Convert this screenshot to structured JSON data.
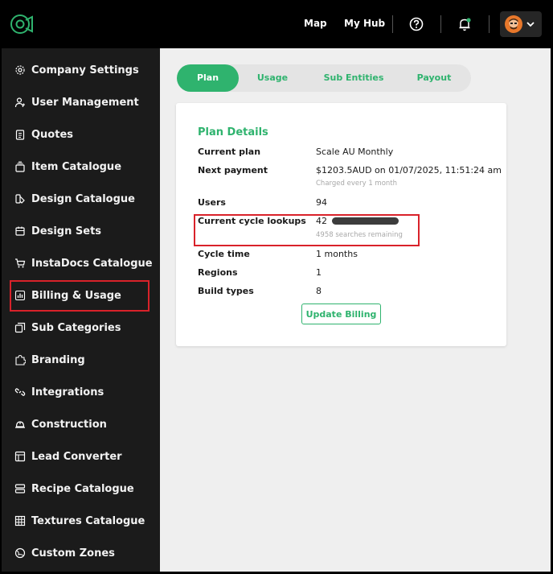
{
  "topbar": {
    "nav": [
      "Map",
      "My Hub"
    ],
    "icons": [
      "help-icon",
      "notification-bell-icon",
      "chevron-down-icon"
    ],
    "notification_dot_color": "#2fb36e"
  },
  "sidebar": {
    "items": [
      {
        "label": "Company Settings",
        "icon": "gear-icon"
      },
      {
        "label": "User Management",
        "icon": "user-icon"
      },
      {
        "label": "Quotes",
        "icon": "clipboard-icon"
      },
      {
        "label": "Item Catalogue",
        "icon": "stack-icon"
      },
      {
        "label": "Design Catalogue",
        "icon": "design-icon"
      },
      {
        "label": "Design Sets",
        "icon": "calendar-icon"
      },
      {
        "label": "InstaDocs Catalogue",
        "icon": "cart-icon"
      },
      {
        "label": "Billing & Usage",
        "icon": "bar-chart-icon",
        "active": true
      },
      {
        "label": "Sub Categories",
        "icon": "sub-categories-icon"
      },
      {
        "label": "Branding",
        "icon": "puzzle-icon"
      },
      {
        "label": "Integrations",
        "icon": "link-icon"
      },
      {
        "label": "Construction",
        "icon": "hardhat-icon"
      },
      {
        "label": "Lead Converter",
        "icon": "layout-icon"
      },
      {
        "label": "Recipe Catalogue",
        "icon": "server-icon"
      },
      {
        "label": "Textures Catalogue",
        "icon": "grid-icon"
      },
      {
        "label": "Custom Zones",
        "icon": "globe-icon"
      }
    ]
  },
  "tabs": [
    {
      "label": "Plan",
      "active": true
    },
    {
      "label": "Usage"
    },
    {
      "label": "Sub Entities"
    },
    {
      "label": "Payout"
    }
  ],
  "plan": {
    "title": "Plan Details",
    "rows": [
      {
        "label": "Current plan",
        "value": "Scale AU Monthly"
      },
      {
        "label": "Next payment",
        "value": "$1203.5AUD on 01/07/2025, 11:51:24 am",
        "sub": "Charged every 1 month"
      },
      {
        "label": "Users",
        "value": "94"
      },
      {
        "label": "Current cycle lookups",
        "value": "42",
        "sub": "4958 searches remaining"
      },
      {
        "label": "Cycle time",
        "value": "1 months"
      },
      {
        "label": "Regions",
        "value": "1"
      },
      {
        "label": "Build types",
        "value": "8"
      }
    ],
    "button": "Update Billing"
  },
  "colors": {
    "accent": "#2fb36e",
    "highlight": "#d9222a",
    "sidebar_bg": "#1b1b1b",
    "main_bg": "#efefef"
  }
}
